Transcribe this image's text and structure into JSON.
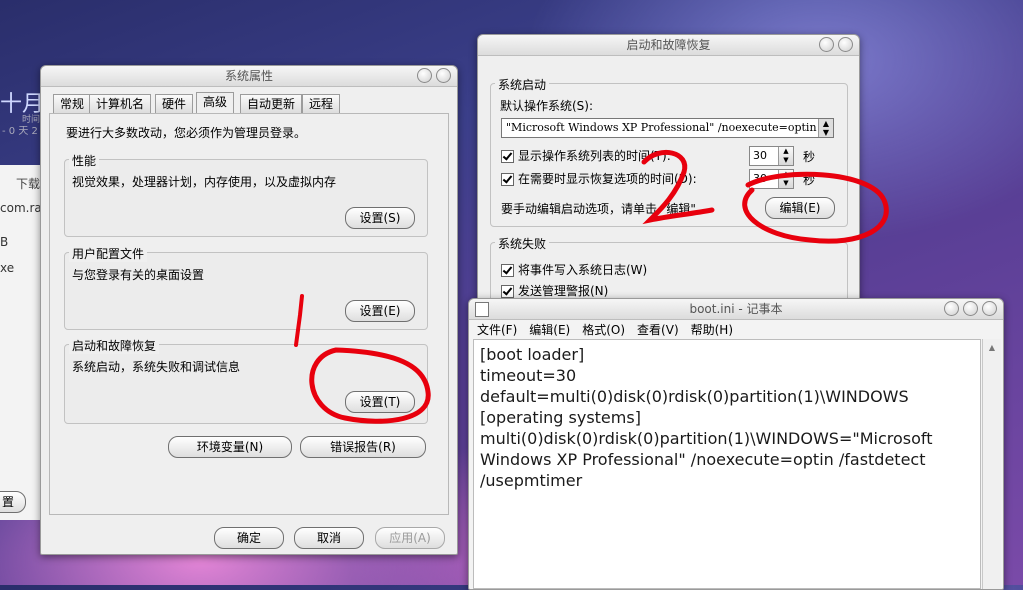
{
  "background_app": {
    "month": "十月",
    "time_label": "时间",
    "remaining": "- 0 天 2",
    "download_label": "下载",
    "file_name": "com.rar",
    "size": "B",
    "ext": "xe",
    "settings_btn": "置"
  },
  "sys_props": {
    "title": "系统属性",
    "tabs": [
      "常规",
      "计算机名",
      "硬件",
      "高级",
      "自动更新",
      "远程"
    ],
    "active_tab": "高级",
    "admin_note": "要进行大多数改动，您必须作为管理员登录。",
    "performance": {
      "legend": "性能",
      "desc": "视觉效果，处理器计划，内存使用，以及虚拟内存",
      "button": "设置(S)"
    },
    "user_profiles": {
      "legend": "用户配置文件",
      "desc": "与您登录有关的桌面设置",
      "button": "设置(E)"
    },
    "startup_recovery": {
      "legend": "启动和故障恢复",
      "desc": "系统启动，系统失败和调试信息",
      "button": "设置(T)"
    },
    "env_vars_btn": "环境变量(N)",
    "error_report_btn": "错误报告(R)",
    "ok_btn": "确定",
    "cancel_btn": "取消",
    "apply_btn": "应用(A)"
  },
  "startup_dialog": {
    "title": "启动和故障恢复",
    "system_startup": "系统启动",
    "default_os_label": "默认操作系统(S):",
    "default_os_value": "\"Microsoft Windows XP Professional\" /noexecute=optin",
    "show_list_label": "显示操作系统列表的时间(T):",
    "show_list_value": "30",
    "show_recovery_label": "在需要时显示恢复选项的时间(D):",
    "show_recovery_value": "30",
    "seconds": "秒",
    "manual_edit_note": "要手动编辑启动选项，请单击 \"编辑\"。",
    "edit_btn": "编辑(E)",
    "system_failure": "系统失败",
    "write_log_label": "将事件写入系统日志(W)",
    "send_alert_label": "发送管理警报(N)"
  },
  "notepad": {
    "title": "boot.ini - 记事本",
    "menu": [
      "文件(F)",
      "编辑(E)",
      "格式(O)",
      "查看(V)",
      "帮助(H)"
    ],
    "content": "[boot loader]\ntimeout=30\ndefault=multi(0)disk(0)rdisk(0)partition(1)\\WINDOWS\n[operating systems]\nmulti(0)disk(0)rdisk(0)partition(1)\\WINDOWS=\"Microsoft Windows XP Professional\" /noexecute=optin /fastdetect /usepmtimer"
  },
  "annotations": {
    "mark_1": "1",
    "mark_2": "2",
    "color": "#e8000d"
  }
}
